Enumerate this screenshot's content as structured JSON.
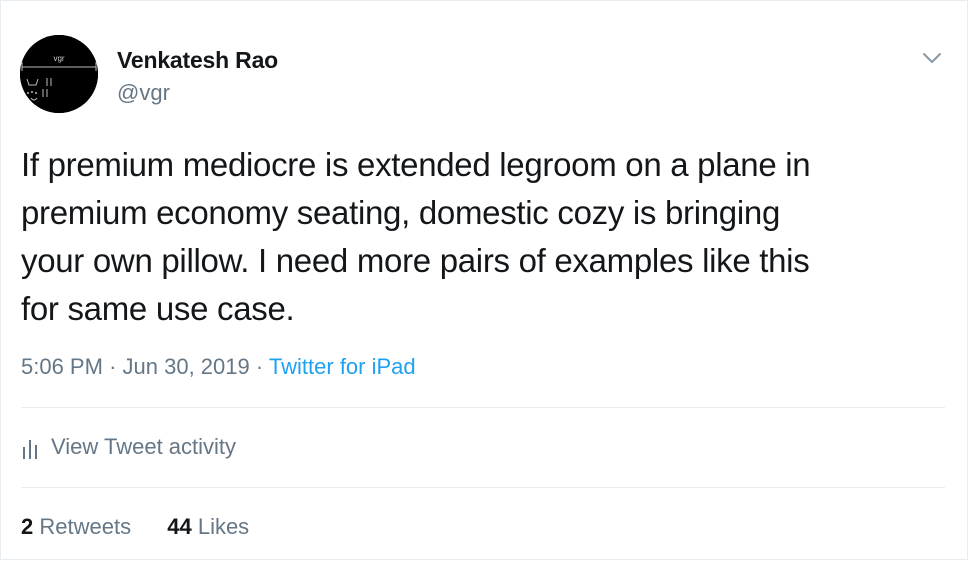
{
  "author": {
    "name": "Venkatesh Rao",
    "handle": "@vgr",
    "avatar_label": "vgr"
  },
  "tweet": {
    "text": "If premium mediocre is extended legroom on a plane in\npremium economy seating, domestic cozy is bringing\nyour own pillow. I need more pairs of examples like this\nfor same use case.",
    "time": "5:06 PM",
    "date": "Jun 30, 2019",
    "separator": "·",
    "source": "Twitter for iPad"
  },
  "activity": {
    "label": "View Tweet activity"
  },
  "stats": {
    "retweets_count": "2",
    "retweets_label": "Retweets",
    "likes_count": "44",
    "likes_label": "Likes"
  },
  "colors": {
    "text": "#14171a",
    "secondary": "#657786",
    "link": "#1da1f2",
    "divider": "#e6ecf0"
  }
}
